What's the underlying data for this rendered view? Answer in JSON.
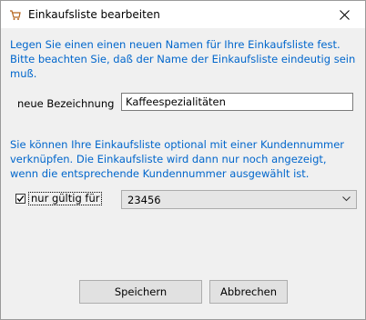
{
  "window": {
    "title": "Einkaufsliste bearbeiten"
  },
  "dialog": {
    "info_text": "Legen Sie einen einen neuen Namen für Ihre Einkaufsliste fest. Bitte beachten Sie, daß der Name der Einkaufsliste eindeutig sein muß.",
    "name_label": "neue Bezeichnung",
    "name_value": "Kaffeespezialitäten",
    "customer_info_text": "Sie können Ihre Einkaufsliste optional mit einer Kundennummer verknüpfen. Die Einkaufsliste wird dann nur noch angezeigt, wenn die entsprechende Kundennummer ausgewählt ist.",
    "checkbox_label": "nur gültig für",
    "checkbox_checked": true,
    "customer_number": "23456",
    "save_label": "Speichern",
    "cancel_label": "Abbrechen"
  },
  "colors": {
    "info_text": "#0066cc",
    "window_bg": "#f0f0f0"
  },
  "icons": {
    "app": "shopping-cart-icon",
    "close": "close-icon",
    "dropdown": "chevron-down-icon",
    "check": "checkmark-icon"
  }
}
